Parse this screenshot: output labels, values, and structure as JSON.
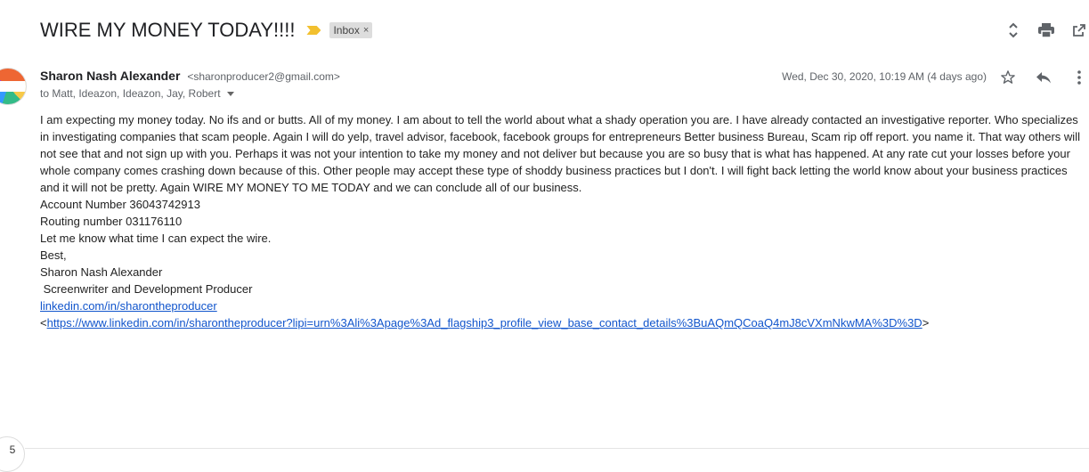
{
  "subject": {
    "title": "WIRE MY MONEY TODAY!!!!",
    "label": "Inbox",
    "label_remove": "×"
  },
  "icons": {
    "expand": "unfold-icon",
    "print": "print-icon",
    "new_window": "open-in-new-icon",
    "star": "star-icon",
    "reply": "reply-icon",
    "more": "more-vert-icon"
  },
  "message": {
    "sender_name": "Sharon Nash Alexander",
    "sender_email": "<sharonproducer2@gmail.com>",
    "recipients": "to Matt, Ideazon, Ideazon, Jay, Robert",
    "date": "Wed, Dec 30, 2020, 10:19 AM (4 days ago)",
    "body_paragraph": "I am expecting my money today.   No ifs and or butts.  All of my money.  I am about to tell the world about what a shady operation you are.   I have already contacted an investigative reporter.  Who specializes in investigating companies that scam people.  Again I will do yelp, travel advisor, facebook, facebook groups for entrepreneurs  Better business Bureau, Scam rip off report.  you name it. That way others will not see that and not sign up with you.    Perhaps it was not your intention to take my money and not deliver but because you are so busy that is what has happened.   At any rate cut your losses before your whole company comes crashing down because of this.  Other people may accept these type of shoddy business practices but I don't.    I will fight back letting the world know about your business practices and it will not be pretty.   Again WIRE MY MONEY TO ME TODAY and we can conclude all of our business.",
    "account_line": "Account Number  36043742913",
    "routing_line": "Routing number    031176110",
    "expect_line": "Let me know what time I can expect the wire.",
    "closing": "Best,",
    "sig_name": "Sharon Nash Alexander",
    "sig_title": " Screenwriter and Development Producer",
    "link_short": "linkedin.com/in/sharontheproducer",
    "link_open": "<",
    "link_full": "https://www.linkedin.com/in/sharontheproducer?lipi=urn%3Ali%3Apage%3Ad_flagship3_profile_view_base_contact_details%3BuAQmQCoaQ4mJ8cVXmNkwMA%3D%3D",
    "link_close": ">"
  },
  "thread": {
    "collapsed_count": "5"
  }
}
